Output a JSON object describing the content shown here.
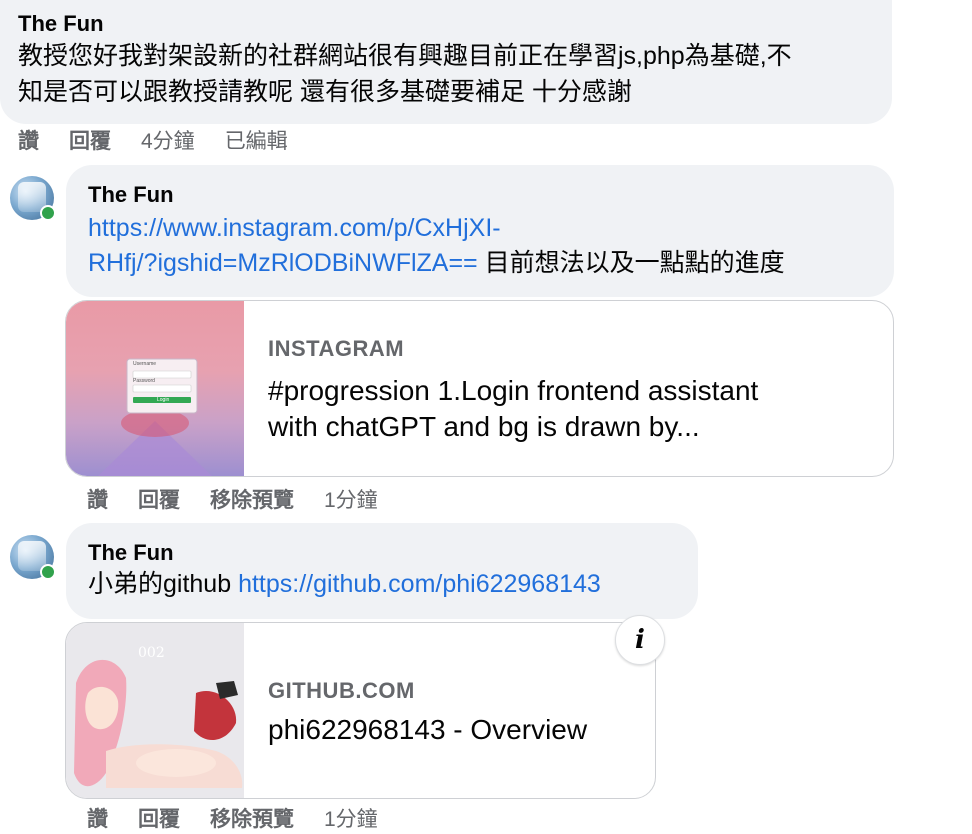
{
  "comment_top": {
    "author": "The Fun",
    "text_line1": "教授您好我對架設新的社群網站很有興趣目前正在學習js,php為基礎,不",
    "text_line2": "知是否可以跟教授請教呢 還有很多基礎要補足 十分感謝",
    "actions": {
      "like": "讚",
      "reply": "回覆",
      "time": "4分鐘",
      "edited": "已編輯"
    }
  },
  "comment_instagram": {
    "author": "The Fun",
    "link_part1": "https://www.instagram.com/p/CxHjXI-",
    "link_part2": "RHfj/?igshid=MzRlODBiNWFlZA==",
    "text_after_link": " 目前想法以及一點點的進度",
    "preview": {
      "domain": "INSTAGRAM",
      "title_line1": "#progression 1.Login frontend assistant",
      "title_line2": "with chatGPT and bg is drawn by...",
      "thumb_labels": {
        "username": "Username",
        "password": "Password",
        "login": "Login"
      }
    },
    "actions": {
      "like": "讚",
      "reply": "回覆",
      "remove_preview": "移除預覽",
      "time": "1分鐘"
    }
  },
  "comment_github": {
    "author": "The Fun",
    "text_before_link": "小弟的github ",
    "link": "https://github.com/phi622968143",
    "preview": {
      "domain": "GITHUB.COM",
      "title": "phi622968143 - Overview",
      "thumb_label": "002"
    },
    "info_button_icon": "i",
    "actions": {
      "like": "讚",
      "reply": "回覆",
      "remove_preview": "移除預覽",
      "time": "1分鐘"
    }
  },
  "colors": {
    "bubble_bg": "#f0f2f5",
    "link": "#216fdb",
    "secondary_text": "#65676b",
    "online": "#31a24c"
  }
}
